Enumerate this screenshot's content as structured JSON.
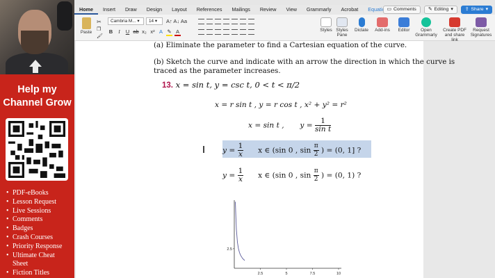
{
  "sidebar": {
    "help_line1": "Help my",
    "help_line2": "Channel Grow",
    "items": [
      "PDF-eBooks",
      "Lesson Request",
      "Live Sessions",
      "Comments",
      "Badges",
      "Crash Courses",
      "Priority Response",
      "Ultimate Cheat",
      "Sheet",
      "Fiction Titles"
    ]
  },
  "ribbon": {
    "tabs": [
      "Home",
      "Insert",
      "Draw",
      "Design",
      "Layout",
      "References",
      "Mailings",
      "Review",
      "View",
      "Grammarly",
      "Acrobat",
      "Equation"
    ],
    "comments_label": "Comments",
    "editing_label": "Editing",
    "share_label": "Share",
    "paste_label": "Paste",
    "font_name": "Cambria M...",
    "font_size": "14",
    "styles_label": "Styles",
    "styles_pane_label": "Styles Pane",
    "dictate_label": "Dictate",
    "addins_label": "Add-ins",
    "editor_label": "Editor",
    "grammarly_label": "Open Grammarly",
    "create_pdf_label": "Create PDF and share link",
    "request_sig_label": "Request Signatures"
  },
  "document": {
    "line_a": "(a) Eliminate the parameter to find a Cartesian equation of the curve.",
    "line_b1": "(b) Sketch the curve and indicate with an arrow the direction in which the curve is",
    "line_b2": "traced as the parameter increases.",
    "problem_number": "13.",
    "problem_eq": "x = sin t,    y = csc t,    0 < t < π/2",
    "polar_eq": "x = r sin t ,      y = r cos t ,      x² + y² = r²",
    "eq_x": "x = sin t ,",
    "eq_y_prefix": "y =",
    "eq_y_num": "1",
    "eq_y_den": "sin t",
    "hl_prefix": "y =",
    "hl_num": "1",
    "hl_den": "x",
    "hl_interval_open": "x ∈ (sin 0 , sin",
    "hl_pi_num": "π",
    "hl_pi_den": "2",
    "hl_interval_close": ") = (0, 1] ?",
    "alt_interval_close": ") = (0, 1) ?"
  },
  "chart_data": {
    "type": "line",
    "xlim": [
      0,
      10
    ],
    "ylim": [
      0,
      8
    ],
    "xticks": [
      "2.5",
      "5",
      "7.5",
      "10"
    ],
    "yticks": [
      "2.5"
    ],
    "series": [
      {
        "x": [
          0.1,
          0.15,
          0.2,
          0.3,
          0.4,
          0.5,
          0.6,
          0.8,
          1.0
        ],
        "y": [
          10,
          6.67,
          5,
          3.33,
          2.5,
          2,
          1.67,
          1.25,
          1
        ]
      }
    ],
    "grid": false,
    "colors": {
      "line": "#5a5a9a"
    }
  },
  "colors": {
    "accent": "#2b579a",
    "promo": "#c8241b",
    "highlight": "#c5d5ea",
    "problem_number": "#b0144c"
  }
}
